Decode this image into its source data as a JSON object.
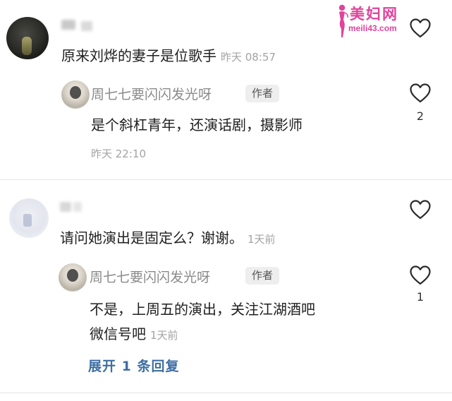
{
  "watermark": {
    "title": "美妇网",
    "url": "meili43.com"
  },
  "comments": [
    {
      "text": "原来刘烨的妻子是位歌手",
      "time": "昨天 08:57",
      "reply": {
        "username": "周七七要闪闪发光呀",
        "badge": "作者",
        "text": "是个斜杠青年，还演话剧，摄影师",
        "time": "昨天 22:10",
        "likes": "2"
      }
    },
    {
      "text": "请问她演出是固定么？谢谢。",
      "time": "1天前",
      "reply": {
        "username": "周七七要闪闪发光呀",
        "badge": "作者",
        "text_line1": "不是，上周五的演出，关注江湖酒吧",
        "text_line2": "微信号吧",
        "time": "1天前",
        "likes": "1"
      },
      "expand_label": "展开 1 条回复"
    }
  ],
  "icons": {
    "like": "heart-outline-icon"
  },
  "colors": {
    "accent_link": "#3d6ea3",
    "watermark": "#e0439c",
    "muted": "#a3a3a3"
  }
}
